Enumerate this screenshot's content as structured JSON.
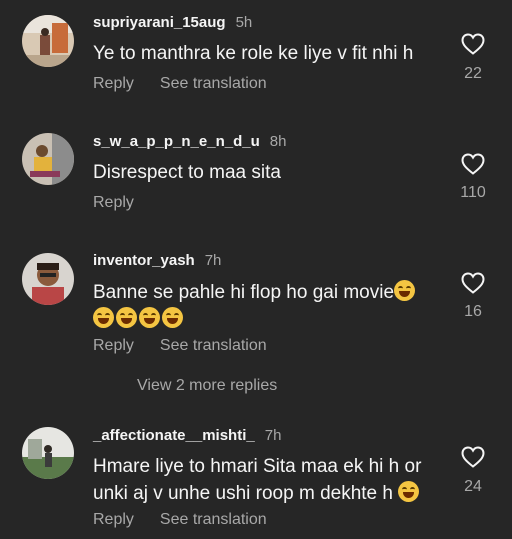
{
  "comments": [
    {
      "username": "supriyarani_15aug",
      "time": "5h",
      "text": "Ye to manthra ke role ke liye v fit nhi h",
      "reply_label": "Reply",
      "translate_label": "See translation",
      "likes": "22"
    },
    {
      "username": "s_w_a_p_p_n_e_n_d_u",
      "time": "8h",
      "text": "Disrespect to maa sita",
      "reply_label": "Reply",
      "likes": "110"
    },
    {
      "username": "inventor_yash",
      "time": "7h",
      "text": "Banne se pahle hi flop ho gai movie",
      "reply_label": "Reply",
      "translate_label": "See translation",
      "likes": "16"
    },
    {
      "username": "_affectionate__mishti_",
      "time": "7h",
      "text_line1": "Hmare liye to hmari Sita maa ek hi h or",
      "text_line2": "unki aj v unhe ushi roop m dekhte h",
      "reply_label": "Reply",
      "translate_label": "See translation",
      "likes": "24"
    }
  ],
  "view_more_label": "View 2 more replies",
  "icons": {
    "like": "heart-outline-icon",
    "emoji": "laughing-tears-emoji"
  }
}
